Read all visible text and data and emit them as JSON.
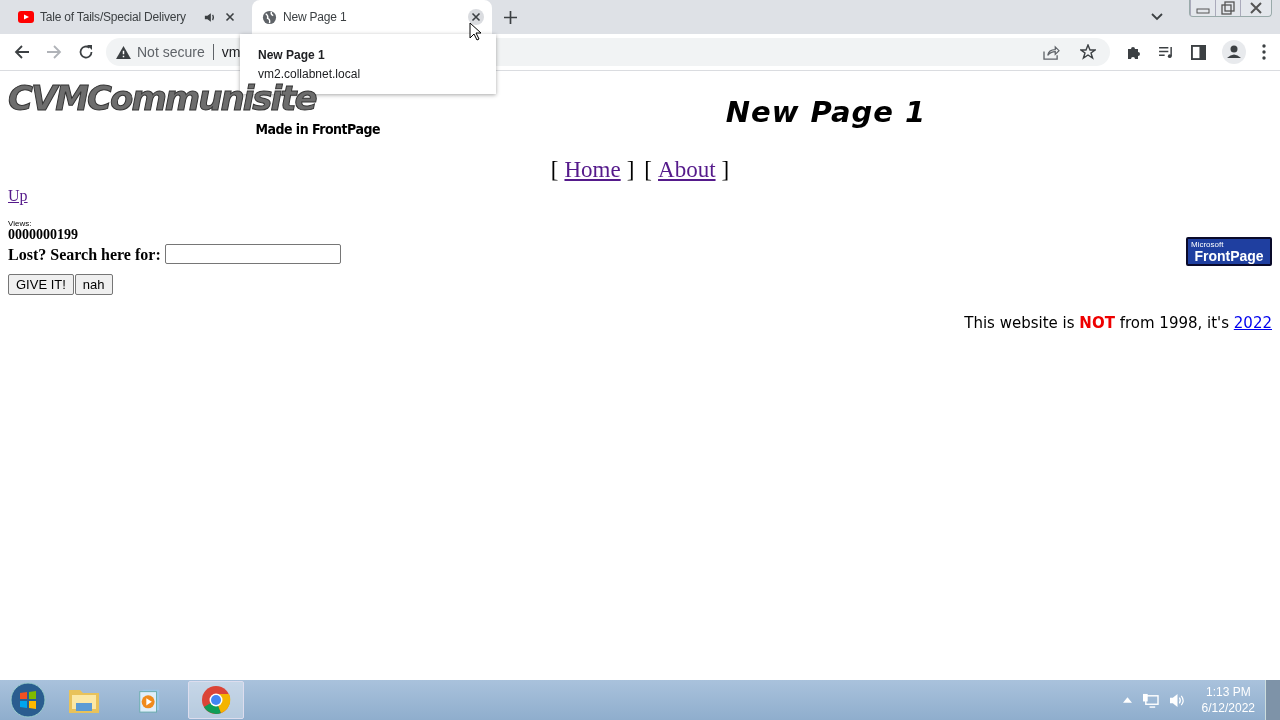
{
  "browser": {
    "tabs": [
      {
        "title": "Tale of Tails/Special Delivery",
        "selected": false,
        "kind": "video",
        "audio": true
      },
      {
        "title": "New Page 1",
        "selected": true,
        "kind": "web",
        "audio": false
      }
    ],
    "tooltip": {
      "title": "New Page 1",
      "url": "vm2.collabnet.local"
    },
    "address": {
      "security": "Not secure",
      "url": "vm"
    }
  },
  "page": {
    "logo": {
      "title": "CVMCommunisite",
      "subtitle": "Made in FrontPage"
    },
    "heading": "New Page 1",
    "nav": {
      "open": "[",
      "close": "]",
      "links": [
        "Home",
        "About"
      ]
    },
    "up_link": "Up",
    "views_label": "Views:",
    "counter": "0000000199",
    "search": {
      "label": "Lost? Search here for:"
    },
    "buttons": [
      "GIVE IT!",
      "nah"
    ],
    "badge": {
      "top": "Microsoft",
      "bottom": "FrontPage"
    },
    "footer": [
      {
        "kind": "plain",
        "text": "This website is "
      },
      {
        "kind": "emph",
        "text": "NOT"
      },
      {
        "kind": "plain",
        "text": " from 1998, it's "
      },
      {
        "kind": "link",
        "text": "2022"
      }
    ]
  },
  "taskbar": {
    "apps": [
      {
        "kind": "folder",
        "selected": false
      },
      {
        "kind": "media",
        "selected": false
      },
      {
        "kind": "chrome",
        "selected": true
      }
    ],
    "time": "1:13 PM",
    "date": "6/12/2022"
  }
}
